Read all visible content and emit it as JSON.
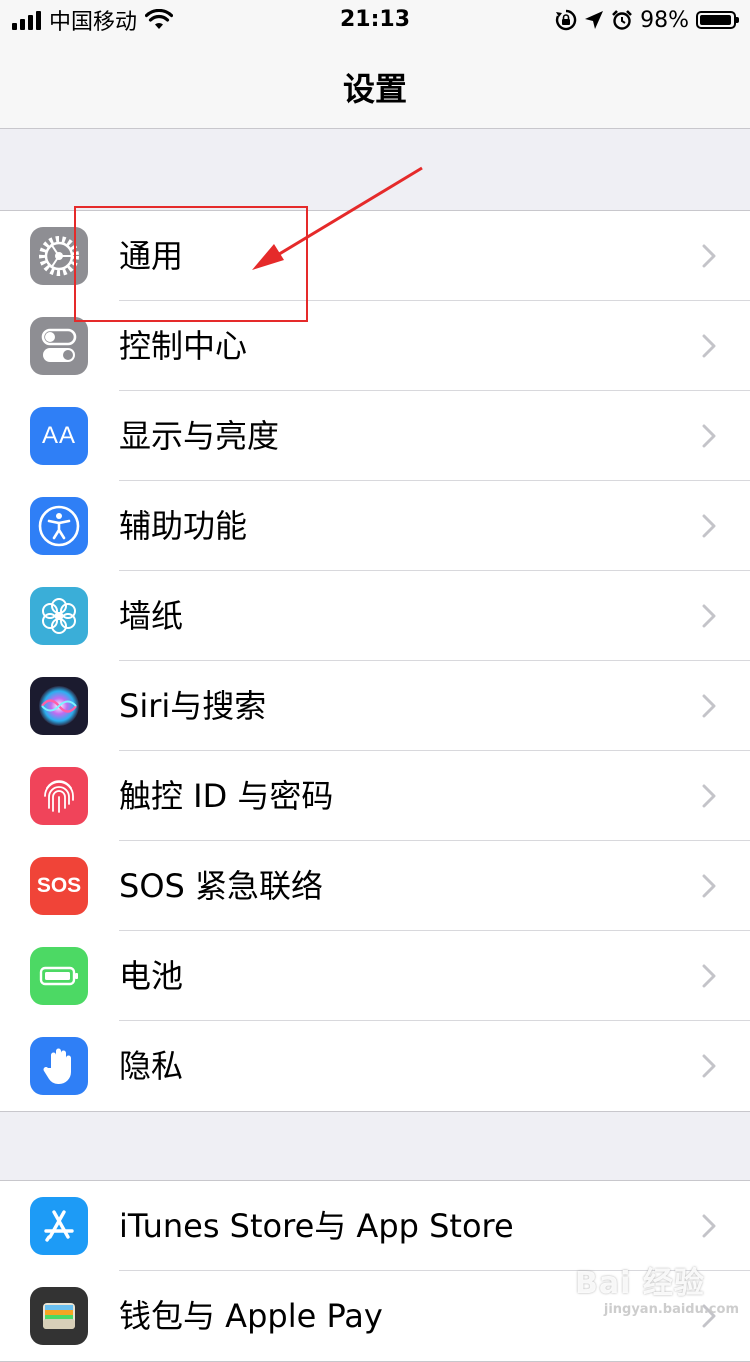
{
  "status_bar": {
    "carrier": "中国移动",
    "time": "21:13",
    "battery_percent": "98%",
    "battery_level": 0.98
  },
  "nav": {
    "title": "设置"
  },
  "group1": [
    {
      "label": "通用",
      "icon": "gear-icon",
      "color": "#8e8e93"
    },
    {
      "label": "控制中心",
      "icon": "toggle-switches-icon",
      "color": "#8e8e93"
    },
    {
      "label": "显示与亮度",
      "icon": "text-size-icon",
      "icon_text": "AA",
      "color": "#2f7ff6"
    },
    {
      "label": "辅助功能",
      "icon": "accessibility-icon",
      "color": "#2f7ff6"
    },
    {
      "label": "墙纸",
      "icon": "flower-icon",
      "color": "#3aaed8"
    },
    {
      "label": "Siri与搜索",
      "icon": "siri-icon",
      "color": "#1b1b2f"
    },
    {
      "label": "触控 ID 与密码",
      "icon": "fingerprint-icon",
      "color": "#f0445a"
    },
    {
      "label": "SOS 紧急联络",
      "icon": "sos-icon",
      "icon_text": "SOS",
      "color": "#f04438"
    },
    {
      "label": "电池",
      "icon": "battery-icon",
      "color": "#4cd964"
    },
    {
      "label": "隐私",
      "icon": "hand-icon",
      "color": "#2f7ff6"
    }
  ],
  "group2": [
    {
      "label": "iTunes Store与 App Store",
      "icon": "app-store-icon",
      "color": "#1d9bf6"
    },
    {
      "label": "钱包与 Apple Pay",
      "icon": "wallet-icon",
      "color": "#333333"
    }
  ],
  "annotation": {
    "color": "#e52a2a"
  },
  "watermark": {
    "main": "Bai 经验",
    "sub": "jingyan.baidu.com"
  }
}
